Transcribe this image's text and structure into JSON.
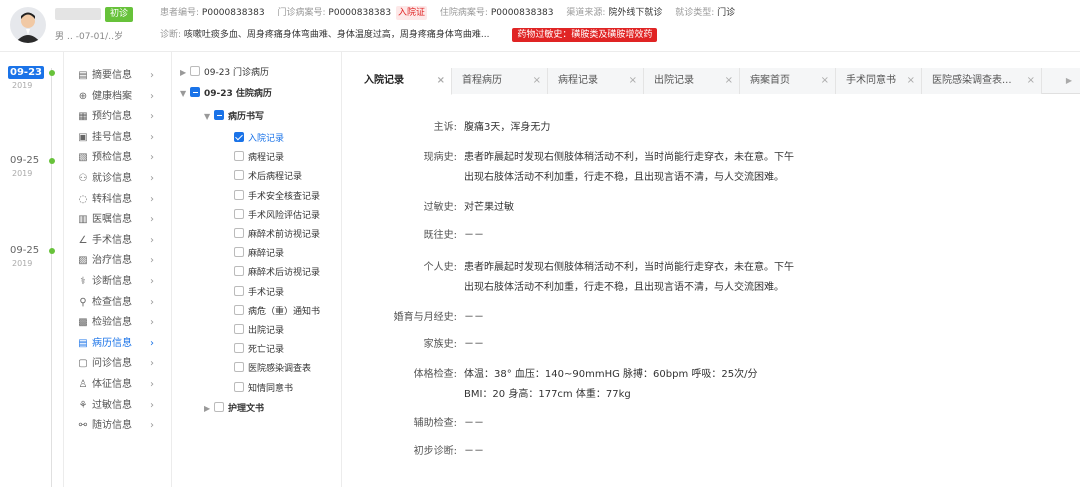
{
  "header": {
    "first_visit_badge": "初诊",
    "gender_age": "男 ‥ -07-01/‥岁",
    "meta": [
      {
        "label": "患者编号:",
        "value": "P0000838383"
      },
      {
        "label": "门诊病案号:",
        "value": "P0000838383"
      },
      {
        "label": "住院病案号:",
        "value": "P0000838383"
      },
      {
        "label": "渠道来源:",
        "value": "院外线下就诊"
      },
      {
        "label": "就诊类型:",
        "value": "门诊"
      }
    ],
    "inpatient_tag": "入院证",
    "diagnosis_label": "诊断:",
    "diagnosis_value": "咳嗽吐痰多血、周身疼痛身体弯曲难、身体温度过高，周身疼痛身体弯曲难...",
    "allergy_tag": "药物过敏史：磺胺类及磺胺增效药"
  },
  "timeline": [
    {
      "date": "09-23",
      "year": "2019",
      "active": true
    },
    {
      "date": "09-25",
      "year": "2019",
      "active": false
    },
    {
      "date": "09-25",
      "year": "2019",
      "active": false
    }
  ],
  "nav": [
    {
      "label": "摘要信息",
      "icon": "summary-icon",
      "glyph": "▤"
    },
    {
      "label": "健康档案",
      "icon": "health-record-icon",
      "glyph": "⊕"
    },
    {
      "label": "预约信息",
      "icon": "calendar-icon",
      "glyph": "▦"
    },
    {
      "label": "挂号信息",
      "icon": "register-icon",
      "glyph": "▣"
    },
    {
      "label": "预检信息",
      "icon": "precheck-icon",
      "glyph": "▧"
    },
    {
      "label": "就诊信息",
      "icon": "visit-icon",
      "glyph": "⚇"
    },
    {
      "label": "转科信息",
      "icon": "transfer-icon",
      "glyph": "◌"
    },
    {
      "label": "医嘱信息",
      "icon": "order-icon",
      "glyph": "▥"
    },
    {
      "label": "手术信息",
      "icon": "surgery-icon",
      "glyph": "∠"
    },
    {
      "label": "治疗信息",
      "icon": "treatment-icon",
      "glyph": "▨"
    },
    {
      "label": "诊断信息",
      "icon": "diagnosis-icon",
      "glyph": "⚕"
    },
    {
      "label": "检查信息",
      "icon": "examination-icon",
      "glyph": "⚲"
    },
    {
      "label": "检验信息",
      "icon": "lab-test-icon",
      "glyph": "▩"
    },
    {
      "label": "病历信息",
      "icon": "medical-record-icon",
      "glyph": "▤",
      "active": true
    },
    {
      "label": "问诊信息",
      "icon": "consultation-icon",
      "glyph": "▢"
    },
    {
      "label": "体征信息",
      "icon": "vital-signs-icon",
      "glyph": "♙"
    },
    {
      "label": "过敏信息",
      "icon": "allergy-icon",
      "glyph": "⚘"
    },
    {
      "label": "随访信息",
      "icon": "followup-icon",
      "glyph": "⚯"
    }
  ],
  "tree": {
    "outpatient": "09-23 门诊病历",
    "inpatient": "09-23 住院病历",
    "writing_group": "病历书写",
    "records": [
      {
        "label": "入院记录",
        "checked": true
      },
      {
        "label": "病程记录"
      },
      {
        "label": "术后病程记录"
      },
      {
        "label": "手术安全核查记录"
      },
      {
        "label": "手术风险评估记录"
      },
      {
        "label": "麻醉术前访视记录"
      },
      {
        "label": "麻醉记录"
      },
      {
        "label": "麻醉术后访视记录"
      },
      {
        "label": "手术记录"
      },
      {
        "label": "病危（重）通知书"
      },
      {
        "label": "出院记录"
      },
      {
        "label": "死亡记录"
      },
      {
        "label": "医院感染调查表"
      },
      {
        "label": "知情同意书"
      }
    ],
    "nursing": "护理文书"
  },
  "tabs": [
    {
      "label": "入院记录",
      "active": true
    },
    {
      "label": "首程病历"
    },
    {
      "label": "病程记录"
    },
    {
      "label": "出院记录"
    },
    {
      "label": "病案首页"
    },
    {
      "label": "手术同意书"
    },
    {
      "label": "医院感染调查表..."
    }
  ],
  "record": {
    "chief_complaint_label": "主诉:",
    "chief_complaint": "腹痛3天，浑身无力",
    "present_illness_label": "现病史:",
    "present_illness": [
      "患者昨晨起时发现右侧肢体稍活动不利，当时尚能行走穿衣，未在意。下午",
      "出现右肢体活动不利加重，行走不稳，且出现言语不清，与人交流困难。"
    ],
    "allergy_label": "过敏史:",
    "allergy": "对芒果过敏",
    "past_label": "既往史:",
    "past": "－－",
    "personal_label": "个人史:",
    "personal": [
      "患者昨晨起时发现右侧肢体稍活动不利，当时尚能行走穿衣，未在意。下午",
      "出现右肢体活动不利加重，行走不稳，且出现言语不清，与人交流困难。"
    ],
    "marital_label": "婚育与月经史:",
    "marital": "－－",
    "family_label": "家族史:",
    "family": "－－",
    "exam_label": "体格检查:",
    "exam": [
      "体温：38°  血压：140~90mmHG  脉搏：60bpm  呼吸：25次/分",
      "BMI：20  身高：177cm  体重：77kg"
    ],
    "aux_label": "辅助检查:",
    "aux": "－－",
    "prelim_label": "初步诊断:",
    "prelim": "－－"
  }
}
